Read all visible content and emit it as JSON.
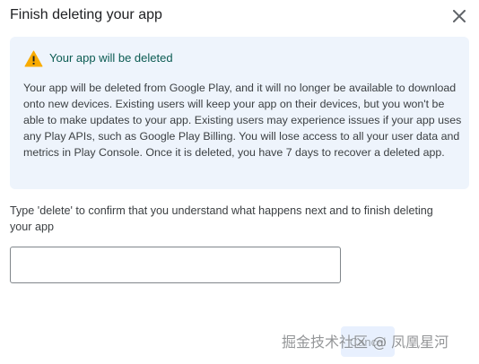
{
  "dialog": {
    "title": "Finish deleting your app",
    "close_icon": "close-icon"
  },
  "warning": {
    "icon": "warning-triangle-icon",
    "icon_color": "#f9ab00",
    "title": "Your app will be deleted",
    "body": "Your app will be deleted from Google Play, and it will no longer be available to download onto new devices. Existing users will keep your app on their devices, but you won't be able to make updates to your app. Existing users may experience issues if your app uses any Play APIs, such as Google Play Billing. You will lose access to all your user data and metrics in Play Console. Once it is deleted, you have 7 days to recover a deleted app."
  },
  "confirm": {
    "label": "Type 'delete' to confirm that you understand what happens next and to finish deleting your app",
    "value": "",
    "placeholder": ""
  },
  "footer": {
    "button_label": "Cancel"
  },
  "watermark": {
    "text": "掘金技术社区 @ 凤凰星河"
  }
}
